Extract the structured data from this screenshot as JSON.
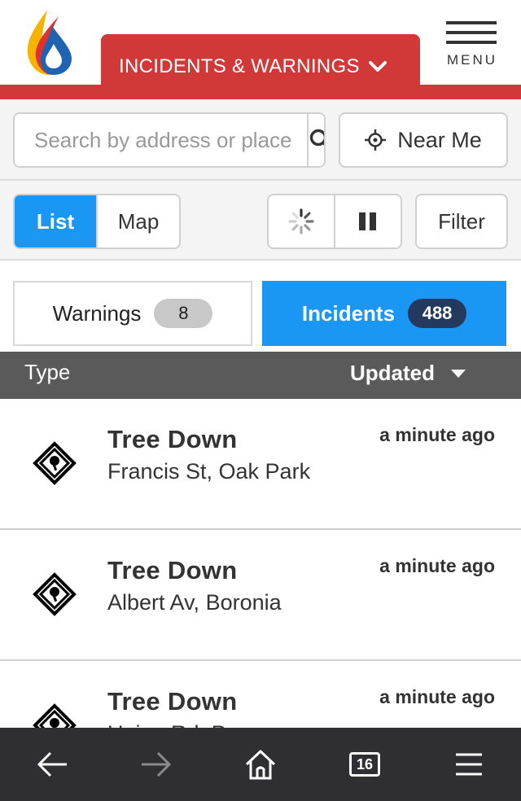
{
  "header": {
    "banner_title": "INCIDENTS & WARNINGS",
    "menu_label": "MENU",
    "colors": {
      "brand_red": "#d13838",
      "accent_blue": "#1a96f5",
      "badge_navy": "#233a5e"
    }
  },
  "search": {
    "placeholder": "Search by address or place",
    "near_me_label": "Near Me"
  },
  "toolbar": {
    "view_list_label": "List",
    "view_map_label": "Map",
    "active_view": "List",
    "filter_label": "Filter"
  },
  "tabs": {
    "warnings": {
      "label": "Warnings",
      "count": "8"
    },
    "incidents": {
      "label": "Incidents",
      "count": "488"
    },
    "active": "Incidents"
  },
  "table": {
    "col_type": "Type",
    "col_updated": "Updated"
  },
  "incidents": [
    {
      "title": "Tree Down",
      "location": "Francis St, Oak Park",
      "updated": "a minute ago",
      "icon": "tree-down-icon"
    },
    {
      "title": "Tree Down",
      "location": "Albert Av, Boronia",
      "updated": "a minute ago",
      "icon": "tree-down-icon"
    },
    {
      "title": "Tree Down",
      "location": "Union Rd, P",
      "updated": "a minute ago",
      "icon": "tree-down-icon"
    }
  ],
  "browser": {
    "tab_count": "16"
  }
}
